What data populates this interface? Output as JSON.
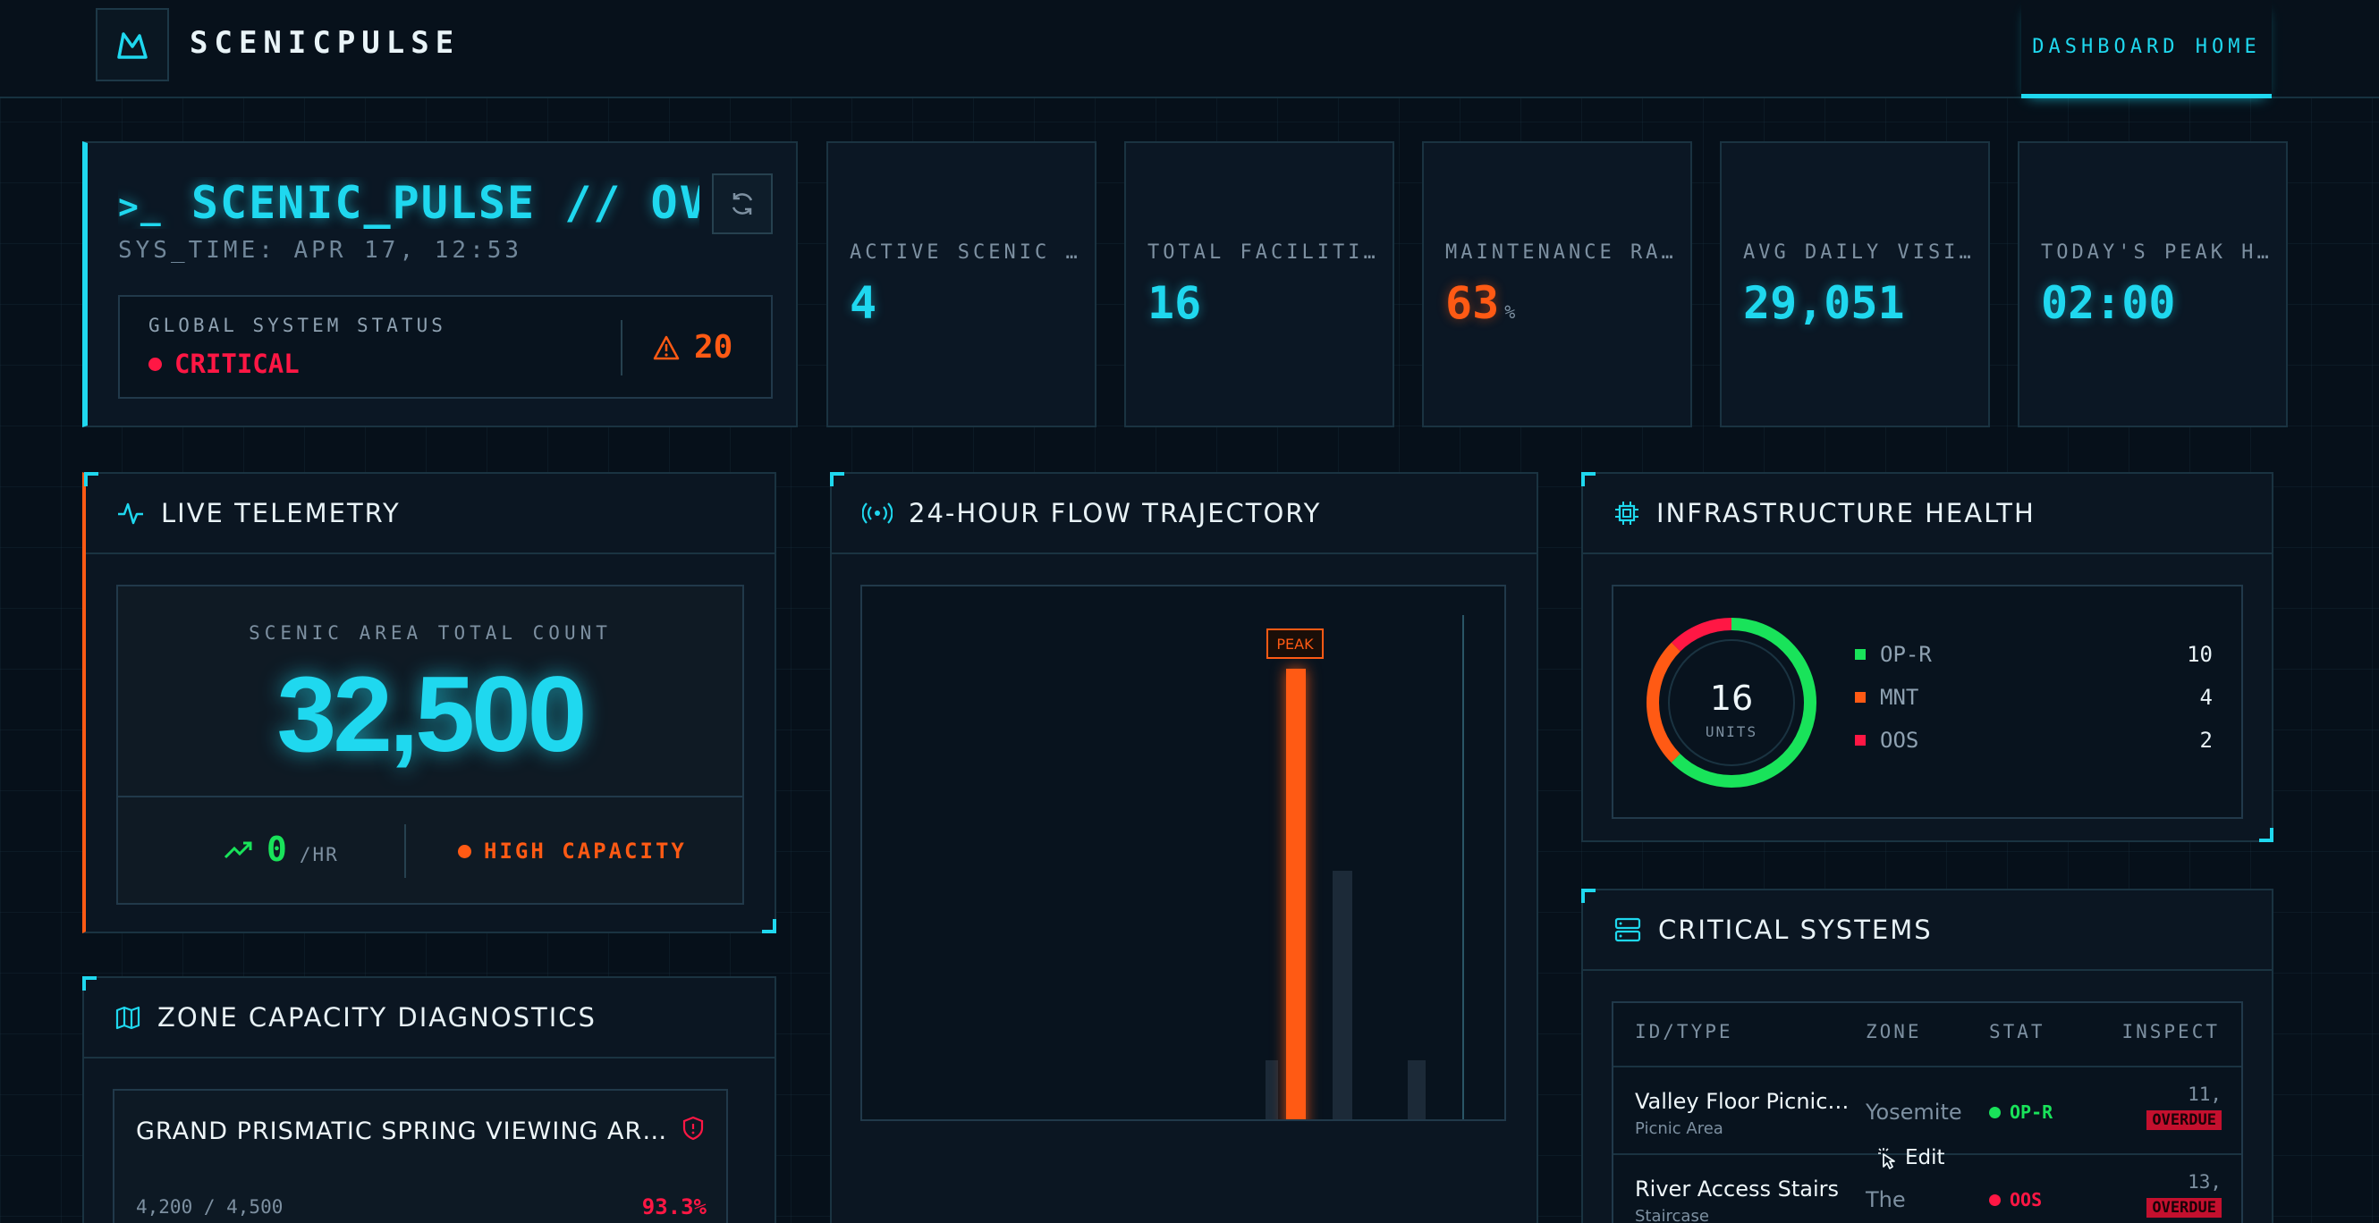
{
  "app": {
    "brand": "SCENICPULSE",
    "nav_home": "DASHBOARD HOME"
  },
  "header": {
    "title": "SCENIC_PULSE // OVERVIEW",
    "sys_time": "SYS_TIME: APR 17, 12:53",
    "status_label": "GLOBAL SYSTEM STATUS",
    "status_value": "CRITICAL",
    "alert_count": "20"
  },
  "kpis": [
    {
      "label": "ACTIVE SCENIC AREAS",
      "value": "4",
      "unit": ""
    },
    {
      "label": "TOTAL FACILITIES",
      "value": "16",
      "unit": ""
    },
    {
      "label": "MAINTENANCE RATE",
      "value": "63",
      "unit": "%"
    },
    {
      "label": "AVG DAILY VISITORS",
      "value": "29,051",
      "unit": ""
    },
    {
      "label": "TODAY'S PEAK HR",
      "value": "02:00",
      "unit": ""
    }
  ],
  "telemetry": {
    "title": "LIVE TELEMETRY",
    "count_label": "SCENIC AREA TOTAL COUNT",
    "count": "32,500",
    "rate": "0",
    "rate_unit": "/HR",
    "capacity_status": "HIGH CAPACITY"
  },
  "flow": {
    "title": "24-HOUR FLOW TRAJECTORY",
    "peak_label": "PEAK"
  },
  "infrastructure": {
    "title": "INFRASTRUCTURE HEALTH",
    "total": "16",
    "total_label": "UNITS",
    "legend": [
      {
        "name": "OP-R",
        "value": "10",
        "color": "#19e35a"
      },
      {
        "name": "MNT",
        "value": "4",
        "color": "#ff5a14"
      },
      {
        "name": "OOS",
        "value": "2",
        "color": "#ff1744"
      }
    ]
  },
  "zones": {
    "title": "ZONE CAPACITY DIAGNOSTICS",
    "items": [
      {
        "name": "GRAND PRISMATIC SPRING VIEWING AREA",
        "ratio": "4,200 / 4,500",
        "percent": "93.3%"
      }
    ]
  },
  "systems": {
    "title": "CRITICAL SYSTEMS",
    "headers": [
      "ID/TYPE",
      "ZONE",
      "STAT",
      "INSPECT"
    ],
    "rows": [
      {
        "name": "Valley Floor Picnic Area",
        "type": "Picnic Area",
        "zone": "Yosemite",
        "stat": "OP-R",
        "inspect": "11,",
        "badge": "OVERDUE"
      },
      {
        "name": "River Access Stairs",
        "type": "Staircase",
        "zone": "The",
        "stat": "OOS",
        "inspect": "13,",
        "badge": "OVERDUE"
      }
    ],
    "edit_label": "Edit"
  },
  "colors": {
    "accent": "#1fd8ef",
    "warning": "#ff5a14",
    "critical": "#ff1744",
    "ok": "#19e35a"
  }
}
